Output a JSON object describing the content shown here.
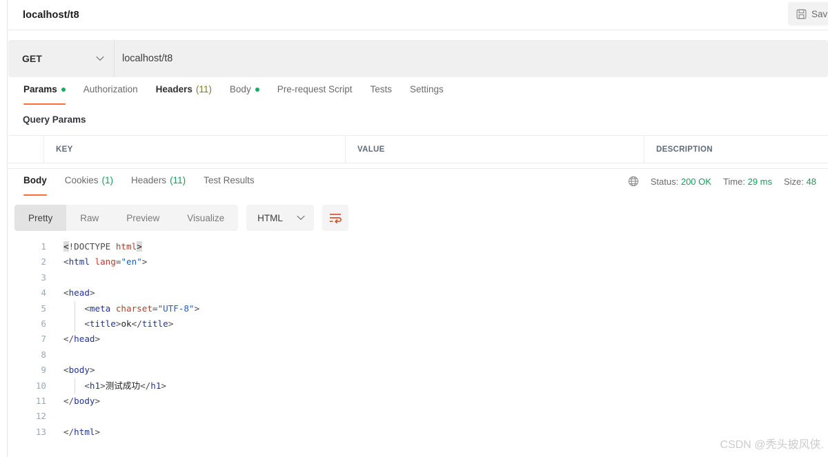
{
  "request": {
    "title": "localhost/t8",
    "save_label": "Sav",
    "save_icon": "floppy-disk-icon",
    "method": "GET",
    "url": "localhost/t8",
    "tabs": [
      {
        "label": "Params",
        "state": "active",
        "dot": true,
        "count": ""
      },
      {
        "label": "Authorization",
        "state": "normal",
        "dot": false,
        "count": ""
      },
      {
        "label": "Headers",
        "state": "semi",
        "dot": false,
        "count": "(11)"
      },
      {
        "label": "Body",
        "state": "normal",
        "dot": true,
        "count": ""
      },
      {
        "label": "Pre-request Script",
        "state": "normal",
        "dot": false,
        "count": ""
      },
      {
        "label": "Tests",
        "state": "normal",
        "dot": false,
        "count": ""
      },
      {
        "label": "Settings",
        "state": "normal",
        "dot": false,
        "count": ""
      }
    ],
    "query_params_label": "Query Params",
    "table_headers": [
      "",
      "KEY",
      "VALUE",
      "DESCRIPTION"
    ]
  },
  "response": {
    "tabs": [
      {
        "label": "Body",
        "state": "active",
        "count": ""
      },
      {
        "label": "Cookies",
        "state": "normal",
        "count": "(1)"
      },
      {
        "label": "Headers",
        "state": "normal",
        "count": "(11)"
      },
      {
        "label": "Test Results",
        "state": "normal",
        "count": ""
      }
    ],
    "meta": {
      "globe_icon": "globe-icon",
      "status_label": "Status:",
      "status_value": "200 OK",
      "time_label": "Time:",
      "time_value": "29 ms",
      "size_label": "Size:",
      "size_value": "48"
    },
    "toolbar": {
      "views": [
        "Pretty",
        "Raw",
        "Preview",
        "Visualize"
      ],
      "active_view": "Pretty",
      "format": "HTML",
      "wrap_icon": "word-wrap-icon"
    },
    "code": {
      "language": "html",
      "lines": [
        {
          "n": "1",
          "tokens": [
            {
              "t": "hl",
              "v": "<"
            },
            {
              "t": "t-dt",
              "v": "!DOCTYPE "
            },
            {
              "t": "t-attr",
              "v": "html"
            },
            {
              "t": "hl",
              "v": ">"
            }
          ]
        },
        {
          "n": "2",
          "tokens": [
            {
              "t": "t-br",
              "v": "<"
            },
            {
              "t": "t-tag",
              "v": "html "
            },
            {
              "t": "t-attr",
              "v": "lang"
            },
            {
              "t": "t-br",
              "v": "="
            },
            {
              "t": "t-str",
              "v": "\"en\""
            },
            {
              "t": "t-br",
              "v": ">"
            }
          ]
        },
        {
          "n": "3",
          "tokens": []
        },
        {
          "n": "4",
          "tokens": [
            {
              "t": "t-br",
              "v": "<"
            },
            {
              "t": "t-tag",
              "v": "head"
            },
            {
              "t": "t-br",
              "v": ">"
            }
          ]
        },
        {
          "n": "5",
          "tokens": [
            {
              "t": "t-br",
              "v": "    <"
            },
            {
              "t": "t-tag",
              "v": "meta "
            },
            {
              "t": "t-attr",
              "v": "charset"
            },
            {
              "t": "t-br",
              "v": "="
            },
            {
              "t": "t-str",
              "v": "\"UTF-8\""
            },
            {
              "t": "t-br",
              "v": ">"
            }
          ]
        },
        {
          "n": "6",
          "tokens": [
            {
              "t": "t-br",
              "v": "    <"
            },
            {
              "t": "t-tag",
              "v": "title"
            },
            {
              "t": "t-br",
              "v": ">"
            },
            {
              "t": "t-txt",
              "v": "ok"
            },
            {
              "t": "t-br",
              "v": "</"
            },
            {
              "t": "t-tag",
              "v": "title"
            },
            {
              "t": "t-br",
              "v": ">"
            }
          ]
        },
        {
          "n": "7",
          "tokens": [
            {
              "t": "t-br",
              "v": "</"
            },
            {
              "t": "t-tag",
              "v": "head"
            },
            {
              "t": "t-br",
              "v": ">"
            }
          ]
        },
        {
          "n": "8",
          "tokens": []
        },
        {
          "n": "9",
          "tokens": [
            {
              "t": "t-br",
              "v": "<"
            },
            {
              "t": "t-tag",
              "v": "body"
            },
            {
              "t": "t-br",
              "v": ">"
            }
          ]
        },
        {
          "n": "10",
          "tokens": [
            {
              "t": "t-br",
              "v": "    <"
            },
            {
              "t": "t-tag",
              "v": "h1"
            },
            {
              "t": "t-br",
              "v": ">"
            },
            {
              "t": "t-txt",
              "v": "测试成功"
            },
            {
              "t": "t-br",
              "v": "</"
            },
            {
              "t": "t-tag",
              "v": "h1"
            },
            {
              "t": "t-br",
              "v": ">"
            }
          ]
        },
        {
          "n": "11",
          "tokens": [
            {
              "t": "t-br",
              "v": "</"
            },
            {
              "t": "t-tag",
              "v": "body"
            },
            {
              "t": "t-br",
              "v": ">"
            }
          ]
        },
        {
          "n": "12",
          "tokens": []
        },
        {
          "n": "13",
          "tokens": [
            {
              "t": "t-br",
              "v": "</"
            },
            {
              "t": "t-tag",
              "v": "html"
            },
            {
              "t": "t-br",
              "v": ">"
            }
          ]
        }
      ]
    }
  },
  "watermark": "CSDN @秃头披风侠.",
  "colors": {
    "accent": "#ff6c37",
    "success": "#10a05a",
    "count": "#7e7a25",
    "dot": "#10b05f"
  }
}
